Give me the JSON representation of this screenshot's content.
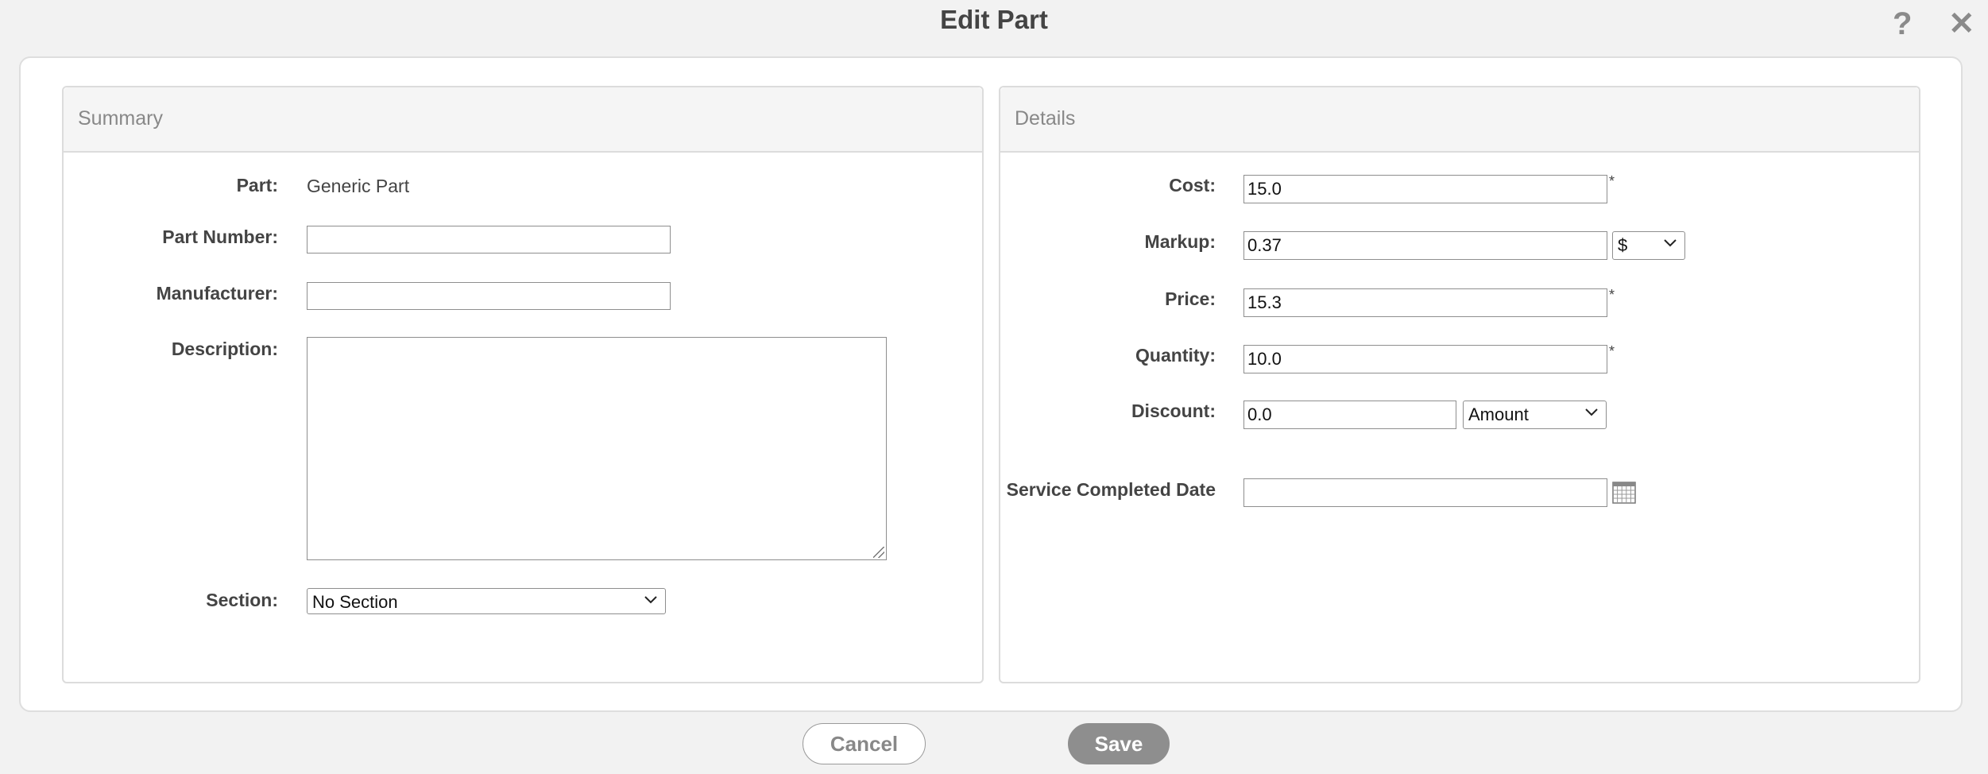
{
  "dialog": {
    "title": "Edit Part",
    "help_icon": "question-mark-icon",
    "close_icon": "close-x-icon"
  },
  "summary": {
    "header": "Summary",
    "part_label": "Part:",
    "part_value": "Generic Part",
    "part_number_label": "Part Number:",
    "part_number_value": "",
    "manufacturer_label": "Manufacturer:",
    "manufacturer_value": "",
    "description_label": "Description:",
    "description_value": "",
    "section_label": "Section:",
    "section_selected": "No Section"
  },
  "details": {
    "header": "Details",
    "cost_label": "Cost:",
    "cost_value": "15.0",
    "markup_label": "Markup:",
    "markup_value": "0.37",
    "markup_unit": "$",
    "price_label": "Price:",
    "price_value": "15.3",
    "quantity_label": "Quantity:",
    "quantity_value": "10.0",
    "discount_label": "Discount:",
    "discount_value": "0.0",
    "discount_type": "Amount",
    "service_date_label": "Service Completed Date",
    "service_date_value": "",
    "required_marker": "*",
    "calendar_icon": "calendar-icon"
  },
  "footer": {
    "cancel_label": "Cancel",
    "save_label": "Save"
  }
}
